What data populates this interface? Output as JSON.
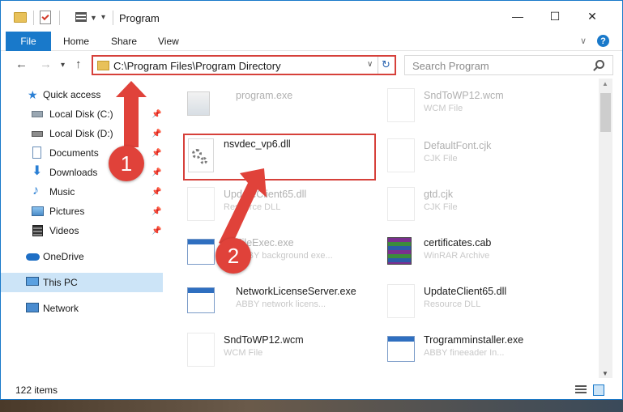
{
  "window": {
    "title": "Program",
    "minimize_glyph": "—",
    "maximize_glyph": "☐",
    "close_glyph": "✕"
  },
  "ribbon": {
    "tabs": [
      "File",
      "Home",
      "Share",
      "View"
    ],
    "help_glyph": "?"
  },
  "address": {
    "path": "C:\\Program Files\\Program Directory"
  },
  "search": {
    "placeholder": "Search Program"
  },
  "nav": {
    "items": [
      {
        "label": "Quick access",
        "icon": "star-icon"
      },
      {
        "label": "Local Disk (C:)",
        "icon": "drive-icon"
      },
      {
        "label": "Local Disk (D:)",
        "icon": "drive-icon"
      },
      {
        "label": "Documents",
        "icon": "documents-icon"
      },
      {
        "label": "Downloads",
        "icon": "download-icon"
      },
      {
        "label": "Music",
        "icon": "music-icon"
      },
      {
        "label": "Pictures",
        "icon": "pictures-icon"
      },
      {
        "label": "Videos",
        "icon": "videos-icon"
      },
      {
        "label": "OneDrive",
        "icon": "cloud-icon"
      },
      {
        "label": "This PC",
        "icon": "computer-icon"
      },
      {
        "label": "Network",
        "icon": "network-icon"
      }
    ]
  },
  "files": [
    {
      "name": "program.exe",
      "type": ""
    },
    {
      "name": "SndToWP12.wcm",
      "type": "WCM File"
    },
    {
      "name": "nsvdec_vp6.dll",
      "type": ""
    },
    {
      "name": "DefaultFont.cjk",
      "type": "CJK File"
    },
    {
      "name": "UpdateClient65.dll",
      "type": "Resource DLL"
    },
    {
      "name": "gtd.cjk",
      "type": "CJK File"
    },
    {
      "name": "FileExec.exe",
      "type": "ABBY background exe..."
    },
    {
      "name": "certificates.cab",
      "type": "WinRAR Archive"
    },
    {
      "name": "NetworkLicenseServer.exe",
      "type": "ABBY network licens..."
    },
    {
      "name": "UpdateClient65.dll",
      "type": "Resource DLL"
    },
    {
      "name": "SndToWP12.wcm",
      "type": "WCM File"
    },
    {
      "name": "Trogramminstaller.exe",
      "type": "ABBY fineeader In..."
    }
  ],
  "status": {
    "count": "122 items"
  },
  "annotations": {
    "step1": "1",
    "step2": "2",
    "color": "#e0423a"
  }
}
